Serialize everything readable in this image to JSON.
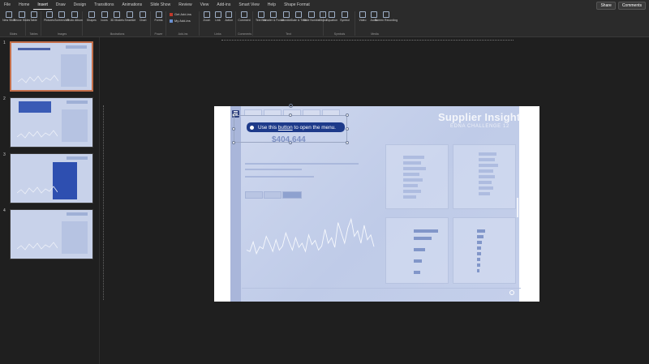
{
  "menu": {
    "tabs": [
      "File",
      "Home",
      "Insert",
      "Draw",
      "Design",
      "Transitions",
      "Animations",
      "Slide Show",
      "Review",
      "View",
      "Add-ins",
      "Smart View",
      "Help",
      "Shape Format"
    ],
    "active": "Insert",
    "share": "Share",
    "comments": "Comments"
  },
  "ribbon": {
    "groups": [
      {
        "label": "Slides",
        "items": [
          "New Slide",
          "Reuse Slides"
        ]
      },
      {
        "label": "Tables",
        "items": [
          "Table"
        ]
      },
      {
        "label": "Images",
        "items": [
          "Pictures",
          "Screenshot",
          "Photo Album"
        ]
      },
      {
        "label": "Illustrations",
        "items": [
          "Shapes",
          "Icons",
          "3D Models",
          "SmartArt",
          "Chart"
        ]
      },
      {
        "label": "Power",
        "items": [
          "Forms"
        ]
      },
      {
        "label": "Add-ins",
        "items": []
      },
      {
        "label": "Links",
        "items": [
          "Zoom",
          "Link",
          "Action"
        ]
      },
      {
        "label": "Comments",
        "items": [
          "Comment"
        ]
      },
      {
        "label": "Text",
        "items": [
          "Text Box",
          "Header & Footer",
          "WordArt",
          "Date & Time",
          "Slide Number",
          "Object"
        ]
      },
      {
        "label": "Symbols",
        "items": [
          "Equation",
          "Symbol"
        ]
      },
      {
        "label": "Media",
        "items": [
          "Video",
          "Audio",
          "Screen Recording"
        ]
      }
    ],
    "addins": {
      "get": "Get Add-ins",
      "my": "My Add-ins"
    }
  },
  "thumbs": [
    {
      "num": "1"
    },
    {
      "num": "2"
    },
    {
      "num": "3"
    },
    {
      "num": "4"
    }
  ],
  "slide": {
    "title": "Supplier Insight",
    "subtitle": "EDNA CHALLENGE 12",
    "tooltip_pre": "Use this ",
    "tooltip_link": "button",
    "tooltip_post": " to open the menu.",
    "big_number": "$404,644"
  },
  "colors": {
    "accent": "#1d3a8a",
    "canvas": "#c8d2ea",
    "selection": "#c46f4a"
  },
  "chart_data": {
    "type": "line",
    "x": [
      1,
      2,
      3,
      4,
      5,
      6,
      7,
      8,
      9,
      10,
      11,
      12,
      13,
      14,
      15,
      16,
      17,
      18,
      19,
      20,
      21,
      22,
      23,
      24,
      25,
      26,
      27,
      28,
      29,
      30,
      31,
      32,
      33,
      34,
      35,
      36,
      37,
      38,
      39,
      40
    ],
    "series": [
      {
        "values": [
          30,
          28,
          42,
          25,
          35,
          32,
          50,
          40,
          28,
          45,
          30,
          36,
          55,
          42,
          30,
          48,
          34,
          40,
          28,
          52,
          38,
          44,
          30,
          36,
          60,
          40,
          48,
          34,
          70,
          55,
          40,
          62,
          75,
          50,
          58,
          40,
          66,
          45,
          52,
          35
        ]
      }
    ],
    "ylim": [
      0,
      80
    ]
  }
}
